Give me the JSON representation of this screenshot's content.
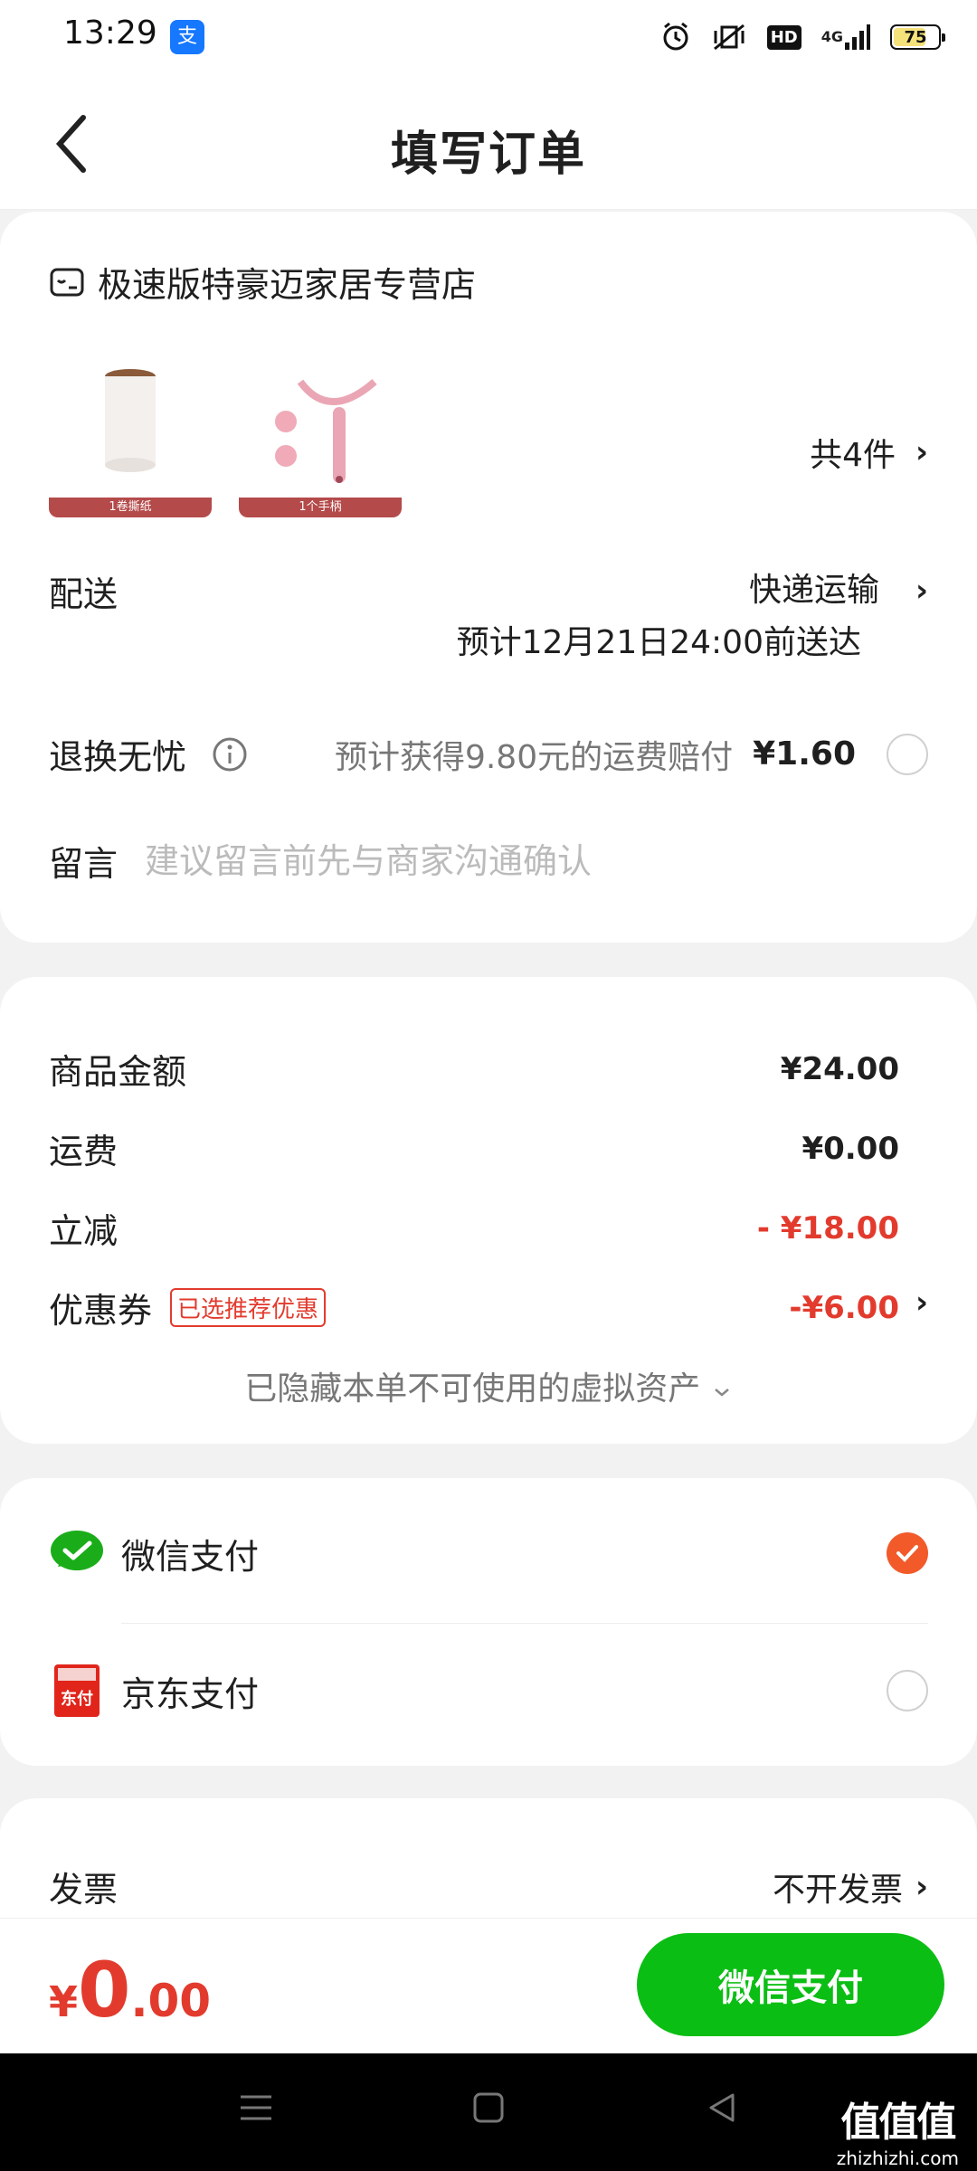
{
  "status_bar": {
    "time": "13:29",
    "app_icon_glyph": "支",
    "hd": "HD",
    "network": "4G",
    "battery": "75",
    "icons": [
      "alarm-icon",
      "vibrate-icon",
      "hd-icon",
      "signal-icon",
      "battery-icon"
    ]
  },
  "header": {
    "title": "填写订单"
  },
  "shop": {
    "name": "极速版特豪迈家居专营店",
    "products": [
      {
        "label": "1卷撕纸"
      },
      {
        "label": "1个手柄"
      }
    ],
    "count": "共4件"
  },
  "delivery": {
    "label": "配送",
    "method": "快递运输",
    "eta": "预计12月21日24:00前送达"
  },
  "returns": {
    "label": "退换无忧",
    "text": "预计获得9.80元的运费赔付",
    "price": "¥1.60",
    "selected": false
  },
  "message": {
    "label": "留言",
    "placeholder": "建议留言前先与商家沟通确认"
  },
  "price": {
    "rows": [
      {
        "label": "商品金额",
        "value": "¥24.00"
      },
      {
        "label": "运费",
        "value": "¥0.00"
      },
      {
        "label": "立减",
        "value": "- ¥18.00"
      },
      {
        "label": "优惠券",
        "tag": "已选推荐优惠",
        "value": "-¥6.00"
      }
    ],
    "hidden_assets": "已隐藏本单不可使用的虚拟资产"
  },
  "payment": {
    "options": [
      {
        "label": "微信支付",
        "selected": true
      },
      {
        "label": "京东支付",
        "selected": false,
        "icon_text": "东付"
      }
    ]
  },
  "invoice": {
    "label": "发票",
    "value": "不开发票"
  },
  "bottom": {
    "currency": "¥",
    "amount_int": "0",
    "amount_dec": ".00",
    "pay_button": "微信支付"
  },
  "watermark": {
    "big": "值值值",
    "small": "zhizhizhi.com"
  },
  "colors": {
    "accent_red": "#e23b2e",
    "wechat_green": "#0bbe14",
    "radio_selected": "#f25a2a"
  }
}
